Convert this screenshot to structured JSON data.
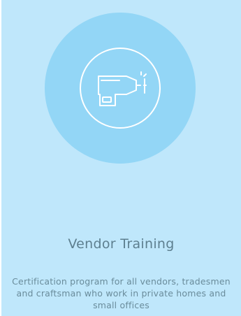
{
  "card": {
    "icon": "drill-icon",
    "title": "Vendor Training",
    "description": "Certification program for all vendors, tradesmen and craftsman who work in private homes and small offices",
    "background_color": "#bfe7fb",
    "circle_color": "#93d6f6"
  }
}
